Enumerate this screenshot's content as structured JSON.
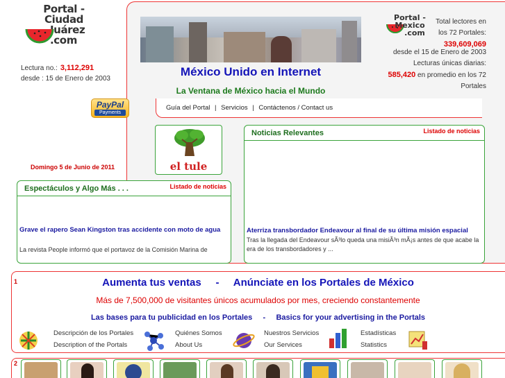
{
  "logo": {
    "line1": "Portal - Ciudad",
    "line2": "Juárez",
    "line3": ".com"
  },
  "counter": {
    "lectura_label": "Lectura no.:",
    "lectura_value": "3,112,291",
    "desde": "desde :   15 de Enero de 2003"
  },
  "paypal": {
    "brand": "PayPal",
    "sub": "Payments"
  },
  "date_text": "Domingo 5 de Junio de 2011",
  "header": {
    "title": "México Unido en Internet",
    "subtitle": "La Ventana de México hacia el Mundo"
  },
  "nav": {
    "items": [
      "Guía del Portal",
      "Servicios",
      "Contáctenos / Contact us"
    ],
    "separator": "|"
  },
  "right_logo": {
    "line1": "Portal -",
    "line2": "Mexico",
    "line3": ".com"
  },
  "stats": {
    "total_label_1": "Total lectores en",
    "total_label_2": "los 72 Portales:",
    "total_value": "339,609,069",
    "since": "desde el 15 de Enero de 2003",
    "daily_label": "Lecturas únicas diarias:",
    "daily_value": "585,420",
    "daily_suffix_1": "en promedio en los 72",
    "daily_suffix_2": "Portales"
  },
  "tule_caption": "el tule",
  "news_box": {
    "title": "Noticias Relevantes",
    "link": "Listado de noticias",
    "item_title": "Aterriza transbordador Endeavour al final de su última misión espacial",
    "item_body": "Tras la llegada del Endeavour sÃ³lo queda una misiÃ³n mÃ¡s antes de que acabe la era de los transbordadores y ..."
  },
  "shows_box": {
    "title": "Espectáculos y Algo Más . . .",
    "link": "Listado de noticias",
    "item_title": "Grave el rapero Sean Kingston tras accidente con moto de agua",
    "item_body": "La revista People informó que el portavoz de la Comisión Marina de"
  },
  "ad": {
    "number": "1",
    "headline_left": "Aumenta tus ventas",
    "headline_sep": "-",
    "headline_right": "Anúnciate en los Portales de México",
    "visitors": "Más de 7,500,000 de visitantes únicos acumulados por mes, creciendo constantemente",
    "bases_es": "Las bases para tu publicidad en los Portales",
    "bases_sep": "-",
    "bases_en": "Basics for your advertising in the Portals",
    "services": [
      {
        "es": "Descripción de los Portales",
        "en": "Description of the Portals",
        "icon": "portal-globe-icon"
      },
      {
        "es": "Quiénes Somos",
        "en": "About Us",
        "icon": "molecule-icon"
      },
      {
        "es": "Nuestros Servicios",
        "en": "Our Services",
        "icon": "planet-icon"
      },
      {
        "es": "Estadísticas",
        "en": "Statistics",
        "icon": "bar-chart-icon"
      }
    ]
  },
  "bottom": {
    "number": "2"
  },
  "colors": {
    "accent_red": "#dd0000",
    "title_blue": "#1414b8",
    "green": "#3aa33a"
  }
}
